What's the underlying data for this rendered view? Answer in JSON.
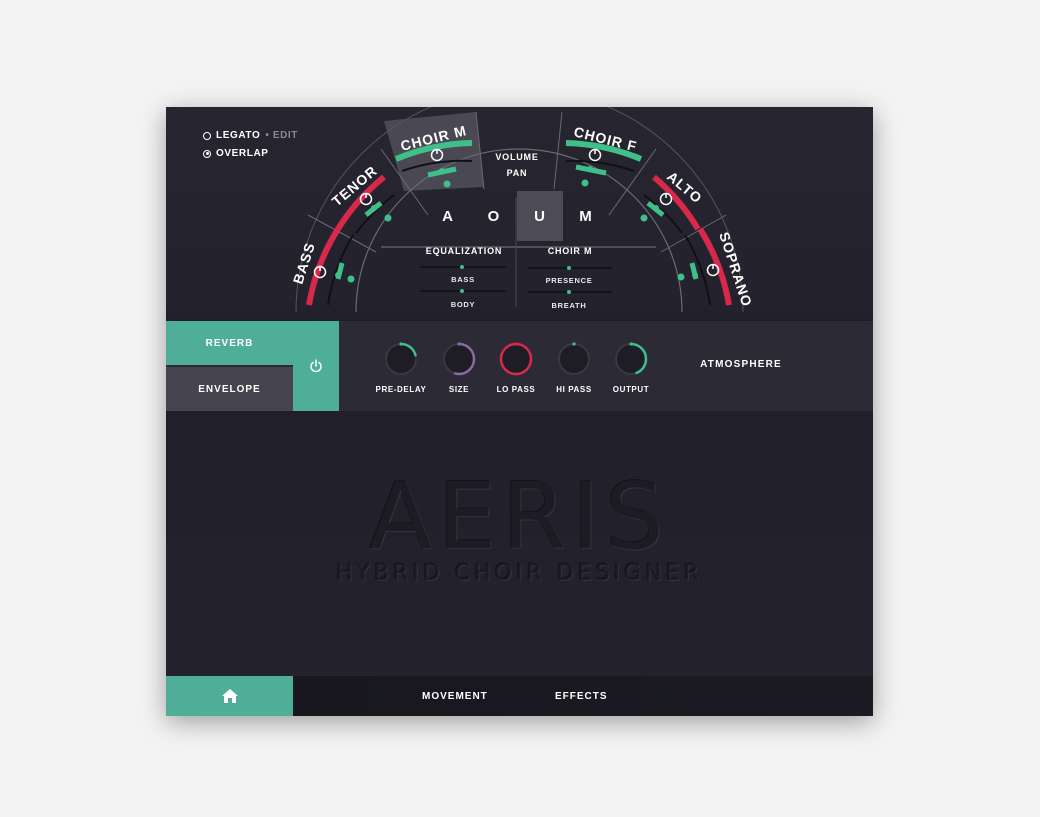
{
  "modes": {
    "legato": "LEGATO",
    "edit": "• EDIT",
    "overlap": "OVERLAP"
  },
  "voices": {
    "bass": "BASS",
    "tenor": "TENOR",
    "choir_m": "CHOIR M",
    "choir_f": "CHOIR F",
    "alto": "ALTO",
    "soprano": "SOPRANO"
  },
  "volume_label": "VOLUME",
  "pan_label": "PAN",
  "vowels": [
    "A",
    "O",
    "U",
    "M"
  ],
  "active_vowel": "U",
  "equalization": {
    "title": "EQUALIZATION",
    "sliders": [
      "BASS",
      "BODY"
    ]
  },
  "voice_panel": {
    "title": "CHOIR M",
    "sliders": [
      "PRESENCE",
      "BREATH"
    ]
  },
  "effects": {
    "tabs": {
      "reverb": "REVERB",
      "envelope": "ENVELOPE"
    },
    "knobs": [
      {
        "label": "PRE-DELAY",
        "value": 0.22,
        "color": "#3fbf8a"
      },
      {
        "label": "SIZE",
        "value": 0.55,
        "color": "#8a6aa0"
      },
      {
        "label": "LO PASS",
        "value": 1.0,
        "color": "#d8294a"
      },
      {
        "label": "HI PASS",
        "value": 0.0,
        "color": "#3fbf8a"
      },
      {
        "label": "OUTPUT",
        "value": 0.45,
        "color": "#3fbf8a"
      }
    ],
    "preset": "ATMOSPHERE"
  },
  "logo": {
    "title": "AERIS",
    "subtitle": "HYBRID CHOIR DESIGNER"
  },
  "nav": {
    "home": "home-icon",
    "movement": "MOVEMENT",
    "effects": "EFFECTS"
  },
  "colors": {
    "accent": "#4fae97",
    "red": "#d8294a",
    "green": "#3fbf8a",
    "panel": "#23222c"
  }
}
